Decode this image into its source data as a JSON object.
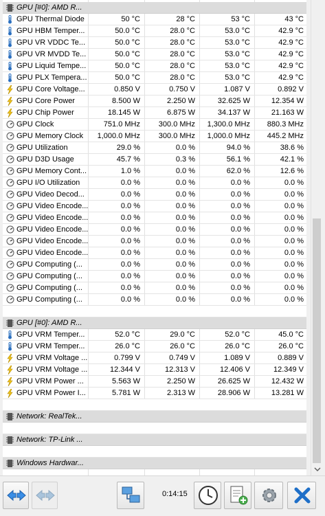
{
  "rows": [
    {
      "type": "header",
      "label": "GPU [#0]: AMD R..."
    },
    {
      "type": "sensor",
      "icon": "thermometer-icon",
      "label": "GPU Thermal Diode",
      "v": [
        "50 °C",
        "28 °C",
        "53 °C",
        "43 °C"
      ]
    },
    {
      "type": "sensor",
      "icon": "thermometer-icon",
      "label": "GPU HBM Temper...",
      "v": [
        "50.0 °C",
        "28.0 °C",
        "53.0 °C",
        "42.9 °C"
      ]
    },
    {
      "type": "sensor",
      "icon": "thermometer-icon",
      "label": "GPU VR VDDC Te...",
      "v": [
        "50.0 °C",
        "28.0 °C",
        "53.0 °C",
        "42.9 °C"
      ]
    },
    {
      "type": "sensor",
      "icon": "thermometer-icon",
      "label": "GPU VR MVDD Te...",
      "v": [
        "50.0 °C",
        "28.0 °C",
        "53.0 °C",
        "42.9 °C"
      ]
    },
    {
      "type": "sensor",
      "icon": "thermometer-icon",
      "label": "GPU Liquid Tempe...",
      "v": [
        "50.0 °C",
        "28.0 °C",
        "53.0 °C",
        "42.9 °C"
      ]
    },
    {
      "type": "sensor",
      "icon": "thermometer-icon",
      "label": "GPU PLX Tempera...",
      "v": [
        "50.0 °C",
        "28.0 °C",
        "53.0 °C",
        "42.9 °C"
      ]
    },
    {
      "type": "sensor",
      "icon": "lightning-icon",
      "label": "GPU Core Voltage...",
      "v": [
        "0.850 V",
        "0.750 V",
        "1.087 V",
        "0.892 V"
      ]
    },
    {
      "type": "sensor",
      "icon": "lightning-icon",
      "label": "GPU Core Power",
      "v": [
        "8.500 W",
        "2.250 W",
        "32.625 W",
        "12.354 W"
      ]
    },
    {
      "type": "sensor",
      "icon": "lightning-icon",
      "label": "GPU Chip Power",
      "v": [
        "18.145 W",
        "6.875 W",
        "34.137 W",
        "21.163 W"
      ]
    },
    {
      "type": "sensor",
      "icon": "gauge-icon",
      "label": "GPU Clock",
      "v": [
        "751.0 MHz",
        "300.0 MHz",
        "1,300.0 MHz",
        "880.3 MHz"
      ]
    },
    {
      "type": "sensor",
      "icon": "gauge-icon",
      "label": "GPU Memory Clock",
      "v": [
        "1,000.0 MHz",
        "300.0 MHz",
        "1,000.0 MHz",
        "445.2 MHz"
      ]
    },
    {
      "type": "sensor",
      "icon": "gauge-icon",
      "label": "GPU Utilization",
      "v": [
        "29.0 %",
        "0.0 %",
        "94.0 %",
        "38.6 %"
      ]
    },
    {
      "type": "sensor",
      "icon": "gauge-icon",
      "label": "GPU D3D Usage",
      "v": [
        "45.7 %",
        "0.3 %",
        "56.1 %",
        "42.1 %"
      ]
    },
    {
      "type": "sensor",
      "icon": "gauge-icon",
      "label": "GPU Memory Cont...",
      "v": [
        "1.0 %",
        "0.0 %",
        "62.0 %",
        "12.6 %"
      ]
    },
    {
      "type": "sensor",
      "icon": "gauge-icon",
      "label": "GPU I/O Utilization",
      "v": [
        "0.0 %",
        "0.0 %",
        "0.0 %",
        "0.0 %"
      ]
    },
    {
      "type": "sensor",
      "icon": "gauge-icon",
      "label": "GPU Video Decod...",
      "v": [
        "0.0 %",
        "0.0 %",
        "0.0 %",
        "0.0 %"
      ]
    },
    {
      "type": "sensor",
      "icon": "gauge-icon",
      "label": "GPU Video Encode...",
      "v": [
        "0.0 %",
        "0.0 %",
        "0.0 %",
        "0.0 %"
      ]
    },
    {
      "type": "sensor",
      "icon": "gauge-icon",
      "label": "GPU Video Encode...",
      "v": [
        "0.0 %",
        "0.0 %",
        "0.0 %",
        "0.0 %"
      ]
    },
    {
      "type": "sensor",
      "icon": "gauge-icon",
      "label": "GPU Video Encode...",
      "v": [
        "0.0 %",
        "0.0 %",
        "0.0 %",
        "0.0 %"
      ]
    },
    {
      "type": "sensor",
      "icon": "gauge-icon",
      "label": "GPU Video Encode...",
      "v": [
        "0.0 %",
        "0.0 %",
        "0.0 %",
        "0.0 %"
      ]
    },
    {
      "type": "sensor",
      "icon": "gauge-icon",
      "label": "GPU Video Encode...",
      "v": [
        "0.0 %",
        "0.0 %",
        "0.0 %",
        "0.0 %"
      ]
    },
    {
      "type": "sensor",
      "icon": "gauge-icon",
      "label": "GPU Computing (...",
      "v": [
        "0.0 %",
        "0.0 %",
        "0.0 %",
        "0.0 %"
      ]
    },
    {
      "type": "sensor",
      "icon": "gauge-icon",
      "label": "GPU Computing (...",
      "v": [
        "0.0 %",
        "0.0 %",
        "0.0 %",
        "0.0 %"
      ]
    },
    {
      "type": "sensor",
      "icon": "gauge-icon",
      "label": "GPU Computing (...",
      "v": [
        "0.0 %",
        "0.0 %",
        "0.0 %",
        "0.0 %"
      ]
    },
    {
      "type": "sensor",
      "icon": "gauge-icon",
      "label": "GPU Computing (...",
      "v": [
        "0.0 %",
        "0.0 %",
        "0.0 %",
        "0.0 %"
      ]
    },
    {
      "type": "spacer"
    },
    {
      "type": "header",
      "label": "GPU [#0]: AMD R..."
    },
    {
      "type": "sensor",
      "icon": "thermometer-icon",
      "label": "GPU VRM Temper...",
      "v": [
        "52.0 °C",
        "29.0 °C",
        "52.0 °C",
        "45.0 °C"
      ]
    },
    {
      "type": "sensor",
      "icon": "thermometer-icon",
      "label": "GPU VRM Temper...",
      "v": [
        "26.0 °C",
        "26.0 °C",
        "26.0 °C",
        "26.0 °C"
      ]
    },
    {
      "type": "sensor",
      "icon": "lightning-icon",
      "label": "GPU VRM Voltage ...",
      "v": [
        "0.799 V",
        "0.749 V",
        "1.089 V",
        "0.889 V"
      ]
    },
    {
      "type": "sensor",
      "icon": "lightning-icon",
      "label": "GPU VRM Voltage ...",
      "v": [
        "12.344 V",
        "12.313 V",
        "12.406 V",
        "12.349 V"
      ]
    },
    {
      "type": "sensor",
      "icon": "lightning-icon",
      "label": "GPU VRM Power ...",
      "v": [
        "5.563 W",
        "2.250 W",
        "26.625 W",
        "12.432 W"
      ]
    },
    {
      "type": "sensor",
      "icon": "lightning-icon",
      "label": "GPU VRM Power I...",
      "v": [
        "5.781 W",
        "2.313 W",
        "28.906 W",
        "13.281 W"
      ]
    },
    {
      "type": "spacer"
    },
    {
      "type": "header",
      "label": "Network: RealTek..."
    },
    {
      "type": "spacer"
    },
    {
      "type": "header",
      "label": "Network: TP-Link ..."
    },
    {
      "type": "spacer"
    },
    {
      "type": "header",
      "label": "Windows Hardwar..."
    }
  ],
  "toolbar": {
    "elapsed_time": "0:14:15"
  }
}
